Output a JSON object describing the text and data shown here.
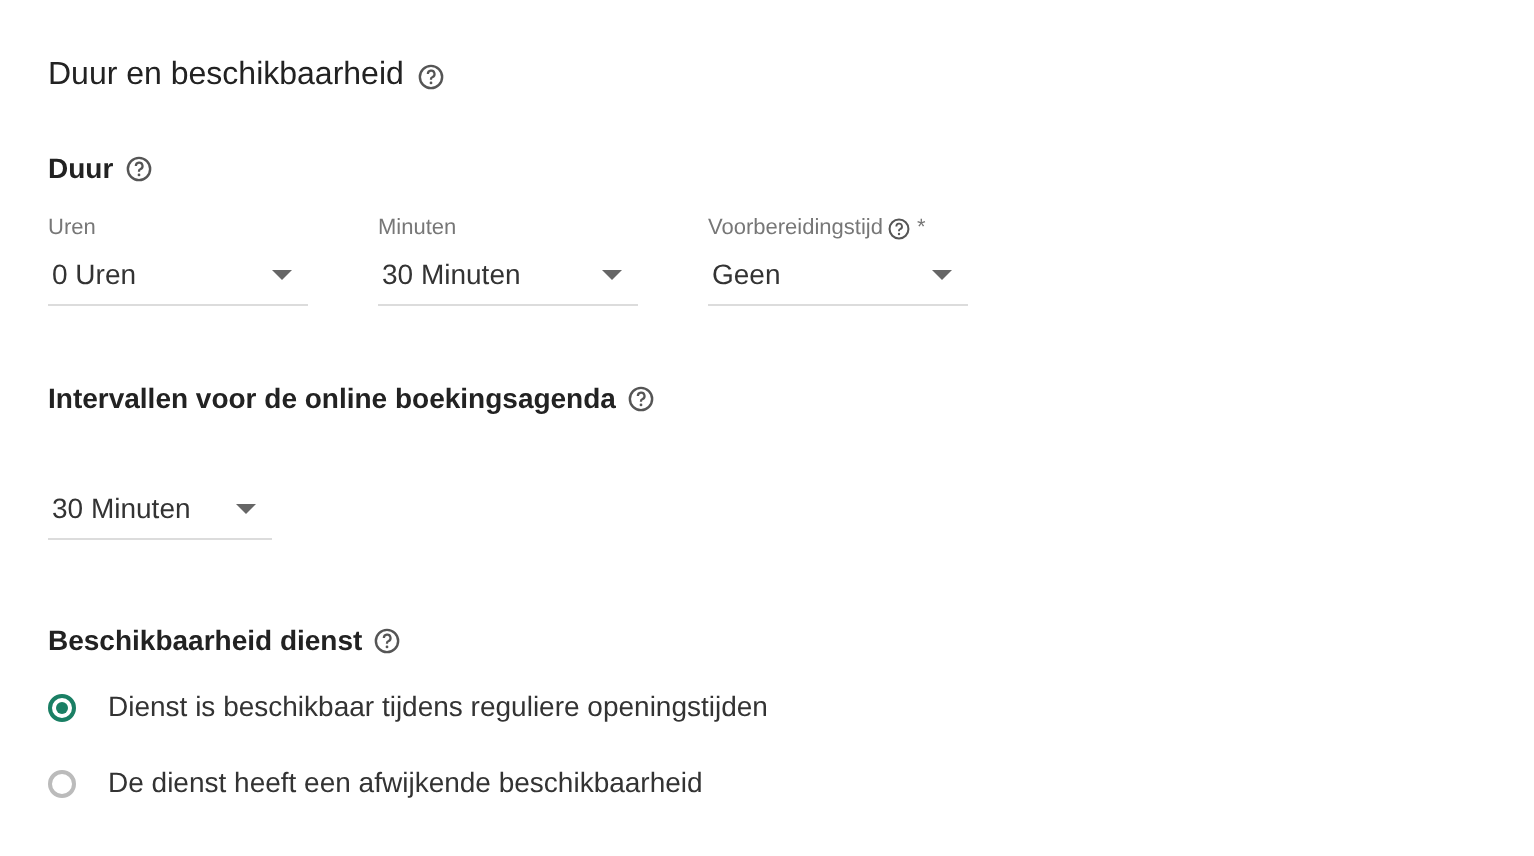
{
  "title": "Duur en beschikbaarheid",
  "duration": {
    "heading": "Duur",
    "fields": [
      {
        "label": "Uren",
        "value": "0 Uren",
        "help": false
      },
      {
        "label": "Minuten",
        "value": "30 Minuten",
        "help": false
      },
      {
        "label": "Voorbereidingstijd",
        "value": "Geen",
        "help": true,
        "required_mark": "*"
      }
    ]
  },
  "interval": {
    "heading": "Intervallen voor de online boekingsagenda",
    "value": "30 Minuten"
  },
  "availability": {
    "heading": "Beschikbaarheid dienst",
    "options": [
      {
        "label": "Dienst is beschikbaar tijdens reguliere openingstijden",
        "selected": true
      },
      {
        "label": "De dienst heeft een afwijkende beschikbaarheid",
        "selected": false
      }
    ]
  }
}
